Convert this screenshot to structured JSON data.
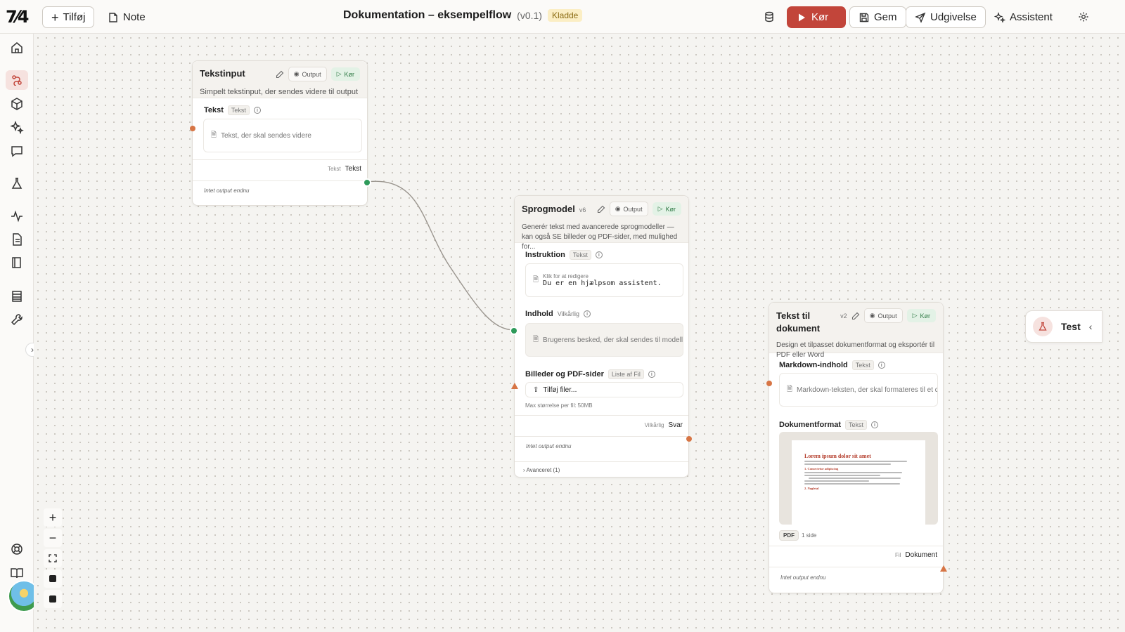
{
  "toolbar": {
    "add_label": "Tilføj",
    "note_label": "Note",
    "flow_title": "Dokumentation – eksempelflow",
    "version": "(v0.1)",
    "status_badge": "Kladde",
    "run_label": "Kør",
    "save_label": "Gem",
    "publish_label": "Udgivelse",
    "assistant_label": "Assistent"
  },
  "sidebar": {
    "items": [
      "home-icon",
      "flows-icon",
      "components-icon",
      "sparkles-icon",
      "chat-icon",
      "flask-icon",
      "activity-icon",
      "document-icon",
      "book-icon",
      "table-icon",
      "wrench-icon",
      "support-icon",
      "docs-icon"
    ],
    "active": "flows-icon"
  },
  "nodes": {
    "text_input": {
      "title": "Tekstinput",
      "description": "Simpelt tekstinput, der sendes videre til output",
      "output_label": "Output",
      "run_label": "Kør",
      "field_label": "Tekst",
      "field_type": "Tekst",
      "placeholder": "Tekst, der skal sendes videre",
      "out_type": "Tekst",
      "out_name": "Tekst",
      "no_output": "Intet output endnu"
    },
    "language_model": {
      "title": "Sprogmodel",
      "version": "v6",
      "description": "Generér tekst med avancerede sprogmodeller — kan også SE billeder og PDF-sider, med mulighed for...",
      "output_label": "Output",
      "run_label": "Kør",
      "instruction_label": "Instruktion",
      "instruction_type": "Tekst",
      "instruction_hint": "Klik for at redigere",
      "instruction_value": "Du er en hjælpsom assistent.",
      "content_label": "Indhold",
      "content_type": "Vilkårlig",
      "content_placeholder": "Brugerens besked, der skal sendes til modellen",
      "files_label": "Billeder og PDF-sider",
      "files_type": "Liste af Fil",
      "files_button": "Tilføj filer...",
      "max_size": "Max størrelse per fil: 50MB",
      "out_type": "Vilkårlig",
      "out_name": "Svar",
      "no_output": "Intet output endnu",
      "advanced": "Avanceret (1)"
    },
    "text_to_document": {
      "title": "Tekst til dokument",
      "version": "v2",
      "description": "Design et tilpasset dokumentformat og eksportér til PDF eller Word",
      "output_label": "Output",
      "run_label": "Kør",
      "markdown_label": "Markdown-indhold",
      "markdown_type": "Tekst",
      "markdown_placeholder": "Markdown-teksten, der skal formateres til et dokument",
      "format_label": "Dokumentformat",
      "format_type": "Tekst",
      "preview_heading": "Lorem ipsum dolor sit amet",
      "preview_section1": "1. Consectetur adipiscing",
      "preview_section2": "2. Nøgletal",
      "pdf_badge": "PDF",
      "pages": "1 side",
      "out_type": "Fil",
      "out_name": "Dokument",
      "no_output": "Intet output endnu"
    }
  },
  "test_panel": {
    "label": "Test"
  },
  "colors": {
    "accent": "#c2453a",
    "run_green": "#2f7a45",
    "port_orange": "#d77545",
    "port_green": "#2e9a5a"
  }
}
